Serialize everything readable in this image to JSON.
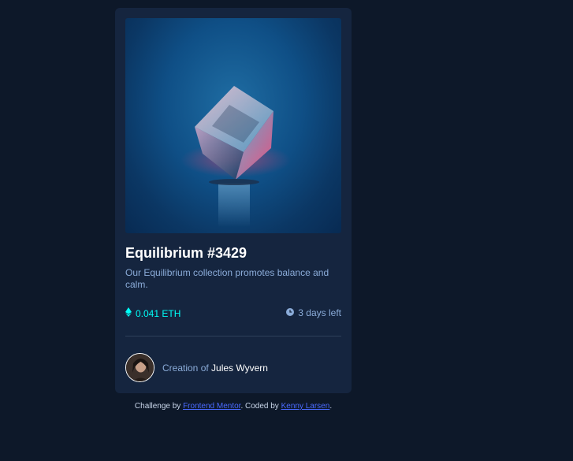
{
  "card": {
    "image_alt": "Equilibrium",
    "title": "Equilibrium #3429",
    "description": "Our Equilibrium collection promotes balance and calm.",
    "price": "0.041 ETH",
    "time_left": "3 days left",
    "creator_prefix": "Creation of",
    "creator_name": "Jules Wyvern"
  },
  "attribution": {
    "prefix": "Challenge by",
    "link1": "Frontend Mentor",
    "middle": ". Coded by",
    "link2": "Kenny Larsen",
    "suffix": "."
  },
  "icons": {
    "price": "ethereum-icon",
    "time": "clock-icon"
  },
  "colors": {
    "background": "#0d1829",
    "card": "#15253f",
    "accent": "#00fff8",
    "soft_blue": "#8bacd9",
    "link": "#4a6aff"
  }
}
